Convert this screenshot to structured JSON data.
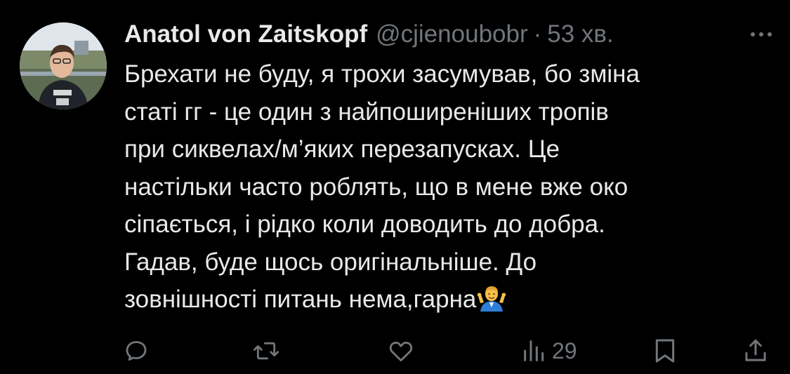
{
  "tweet": {
    "author": {
      "display_name": "Anatol von Zaitskopf",
      "handle": "@cjienoubobr",
      "avatar_icon": "user-avatar-photo"
    },
    "separator": "·",
    "timestamp": "53 хв.",
    "more_icon": "more-horizontal-icon",
    "text_lines": [
      "Брехати не буду, я трохи засумував, бо зміна",
      "статі гг - це один з найпоширеніших тропів",
      "при сиквелах/м’яких перезапусках. Це",
      "настільки часто роблять, що в мене вже око",
      "сіпається, і рідко коли доводить до добра.",
      "Гадав, буде щось оригінальніше. До",
      "зовнішності питань нема,гарна"
    ],
    "emoji": "shrug-emoji",
    "actions": {
      "reply_icon": "reply-icon",
      "retweet_icon": "retweet-icon",
      "like_icon": "like-heart-icon",
      "views_icon": "views-bar-chart-icon",
      "views_count": "29",
      "bookmark_icon": "bookmark-icon",
      "share_icon": "share-icon"
    }
  },
  "colors": {
    "background": "#000000",
    "text_primary": "#e7e9ea",
    "text_secondary": "#71767b"
  }
}
